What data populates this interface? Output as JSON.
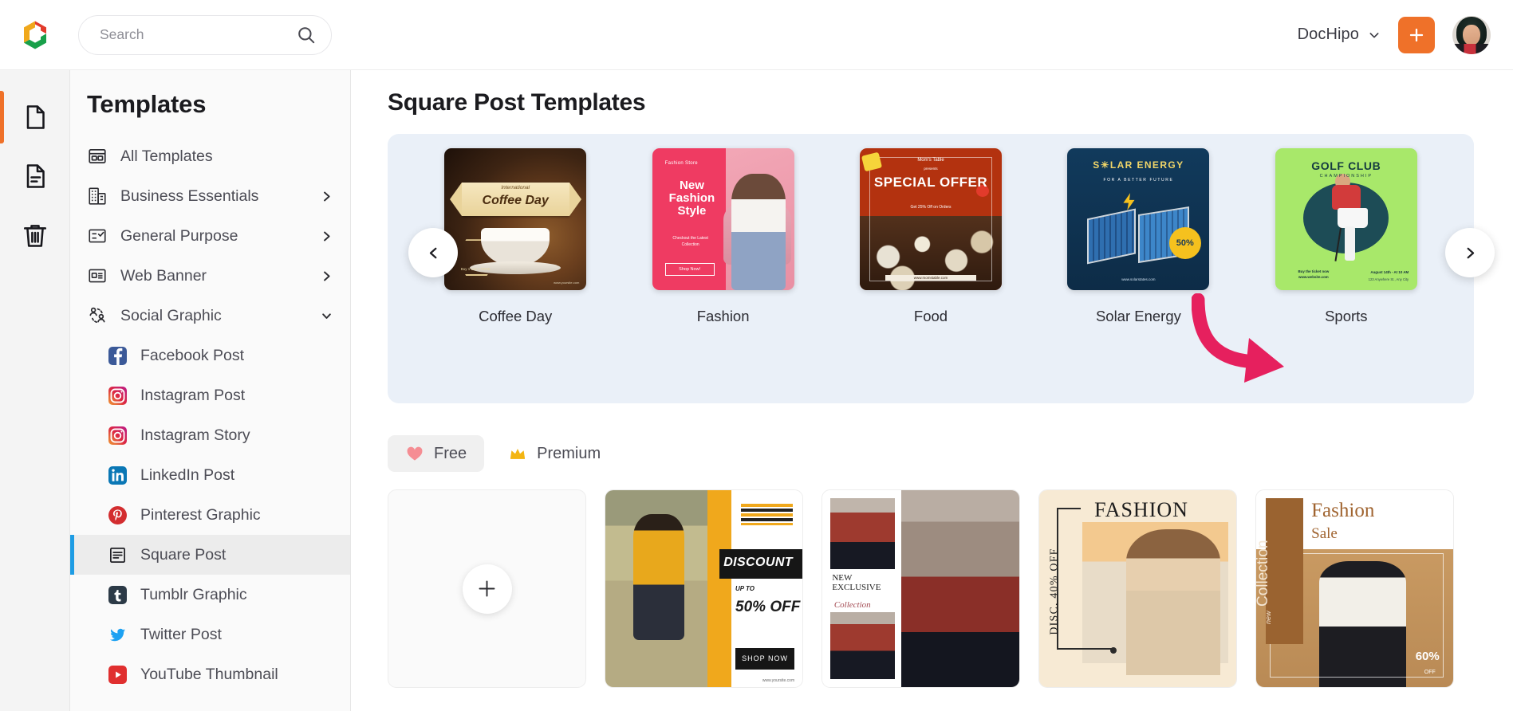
{
  "app": {
    "logo_name": "dochipo-logo",
    "accent_orange": "#ef7129",
    "accent_blue": "#1e9ce4",
    "annotation_pink": "#e6205e",
    "carousel_bg": "#eaf0f8"
  },
  "header": {
    "search_placeholder": "Search",
    "search_value": "",
    "account_name": "DocHipo",
    "plus_label": "+"
  },
  "rail": {
    "items": [
      {
        "name": "documents-icon",
        "label": "Documents",
        "active": true
      },
      {
        "name": "templates-doc-icon",
        "label": "My Templates",
        "active": false
      },
      {
        "name": "trash-icon",
        "label": "Trash",
        "active": false
      }
    ]
  },
  "sidebar": {
    "title": "Templates",
    "items": [
      {
        "label": "All Templates",
        "icon": "all-templates-icon",
        "expandable": false,
        "expanded": false
      },
      {
        "label": "Business Essentials",
        "icon": "business-icon",
        "expandable": true,
        "expanded": false
      },
      {
        "label": "General Purpose",
        "icon": "general-purpose-icon",
        "expandable": true,
        "expanded": false
      },
      {
        "label": "Web Banner",
        "icon": "web-banner-icon",
        "expandable": true,
        "expanded": false
      },
      {
        "label": "Social Graphic",
        "icon": "social-graphic-icon",
        "expandable": true,
        "expanded": true
      }
    ],
    "sub_items": [
      {
        "label": "Facebook Post",
        "icon": "facebook-icon",
        "color": "#3b5998",
        "active": false
      },
      {
        "label": "Instagram Post",
        "icon": "instagram-icon",
        "color": "#e1306c",
        "active": false
      },
      {
        "label": "Instagram Story",
        "icon": "instagram-icon",
        "color": "#e1306c",
        "active": false
      },
      {
        "label": "LinkedIn Post",
        "icon": "linkedin-icon",
        "color": "#0a77b5",
        "active": false
      },
      {
        "label": "Pinterest Graphic",
        "icon": "pinterest-icon",
        "color": "#d32d2f",
        "active": false
      },
      {
        "label": "Square Post",
        "icon": "square-post-icon",
        "color": "#2b2b2b",
        "active": true
      },
      {
        "label": "Tumblr Graphic",
        "icon": "tumblr-icon",
        "color": "#2c3a47",
        "active": false
      },
      {
        "label": "Twitter Post",
        "icon": "twitter-icon",
        "color": "#1da1f2",
        "active": false
      },
      {
        "label": "YouTube Thumbnail",
        "icon": "youtube-icon",
        "color": "#e02f2f",
        "active": false
      }
    ]
  },
  "main": {
    "page_title": "Square Post Templates",
    "carousel": {
      "prev_label": "‹",
      "next_label": "›",
      "tiles": [
        {
          "caption": "Coffee Day",
          "art": "coffee",
          "text_lines": [
            "International",
            "Coffee Day",
            "Buy 1 Get 1 FREE",
            "www.yoursite.com"
          ]
        },
        {
          "caption": "Fashion",
          "art": "fashion",
          "text_lines": [
            "Fashion Store",
            "New Fashion Style",
            "Checkout the Latest Collection",
            "Shop Now!"
          ]
        },
        {
          "caption": "Food",
          "art": "food",
          "text_lines": [
            "Mom's Table",
            "presents",
            "SPECIAL OFFER",
            "Get 25% Off on Orders",
            "www.momstable.com"
          ]
        },
        {
          "caption": "Solar Energy",
          "art": "solar",
          "text_lines": [
            "S☀LAR ENERGY",
            "FOR A BETTER FUTURE",
            "50%",
            "www.solarstates.com"
          ]
        },
        {
          "caption": "Sports",
          "art": "sports",
          "text_lines": [
            "GOLF CLUB",
            "CHAMPIONSHIP",
            "Buy the ticket now www.website.com",
            "August 14th - At 10 AM",
            "123 Anywhere St., Any City"
          ]
        }
      ]
    },
    "filters": [
      {
        "label": "Free",
        "icon": "heart-icon",
        "active": true
      },
      {
        "label": "Premium",
        "icon": "crown-icon",
        "active": false
      }
    ],
    "grid": [
      {
        "kind": "blank",
        "name": "create-blank-square-post",
        "plus_label": "+"
      },
      {
        "kind": "template",
        "name": "discount-template",
        "text_lines": [
          "DISCOUNT",
          "UP TO",
          "50% OFF",
          "SHOP NOW",
          "www.yoursite.com"
        ]
      },
      {
        "kind": "template",
        "name": "new-exclusive-template",
        "text_lines": [
          "NEW EXCLUSIVE",
          "Collection"
        ]
      },
      {
        "kind": "template",
        "name": "fashion-disc-template",
        "text_lines": [
          "FASHION",
          "DISC. 40% OFF"
        ]
      },
      {
        "kind": "template",
        "name": "fashion-sale-template",
        "text_lines": [
          "Fashion",
          "Sale",
          "new",
          "Collection",
          "60%",
          "OFF"
        ]
      }
    ]
  }
}
